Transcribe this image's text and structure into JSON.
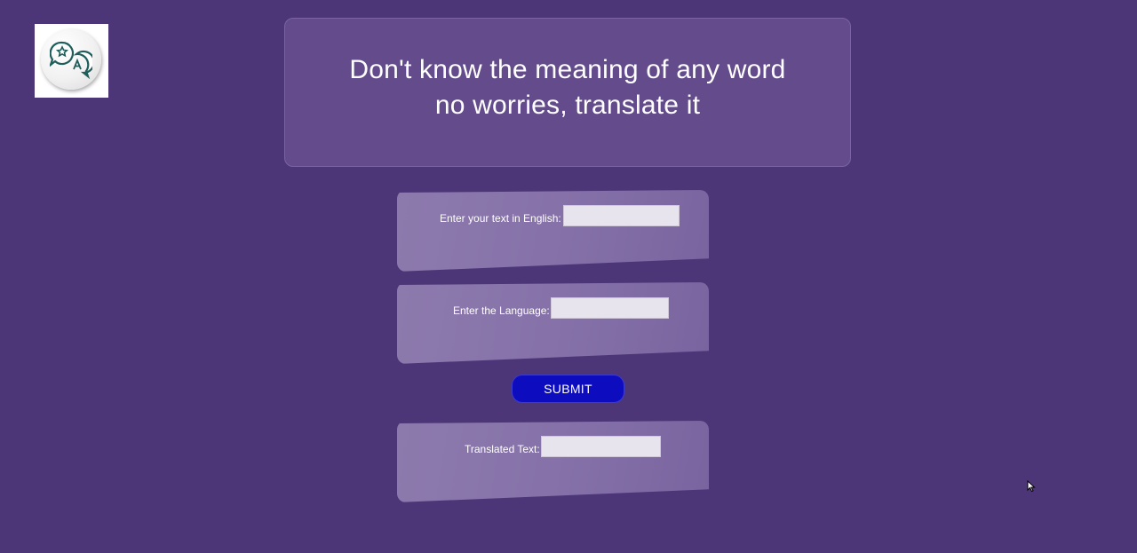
{
  "logo": {
    "icon": "translate-icon"
  },
  "hero": {
    "line1": "Don't know the meaning of any word",
    "line2": "no worries, translate it"
  },
  "form": {
    "english_text": {
      "label": "Enter your text in English:",
      "value": ""
    },
    "language": {
      "label": "Enter the Language:",
      "value": ""
    },
    "submit_label": "SUBMIT",
    "translated": {
      "label": "Translated Text:",
      "value": ""
    }
  },
  "colors": {
    "background": "#4d3677",
    "hero_panel": "#634b8c",
    "card": "#8571a8",
    "submit_button": "#0d0dbf"
  }
}
